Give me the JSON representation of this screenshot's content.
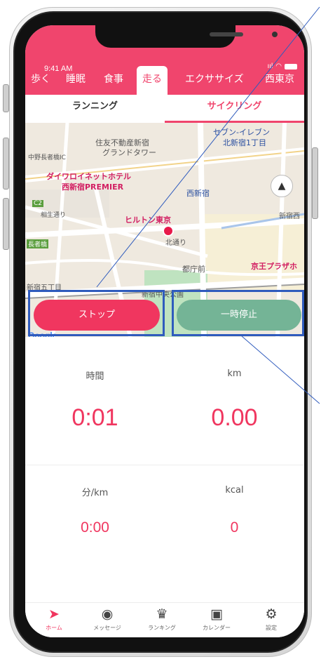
{
  "status_bar": {
    "time": "9:41 AM",
    "signal": "ııl"
  },
  "category_tabs": [
    {
      "label": "歩く"
    },
    {
      "label": "睡眠"
    },
    {
      "label": "食事"
    },
    {
      "label": "走る"
    },
    {
      "label": "エクササイズ"
    },
    {
      "label": "西東京"
    }
  ],
  "active_category": "走る",
  "sub_tabs": {
    "running": "ランニング",
    "cycling": "サイクリング",
    "active": "サイクリング"
  },
  "map": {
    "labels": {
      "seven_eleven_1": "セブン-イレブン",
      "seven_eleven_2": "北新宿1丁目",
      "sumitomo_1": "住友不動産新宿",
      "sumitomo_2": "グランドタワー",
      "nakano": "中野長者橋IC",
      "daiwa_1": "ダイワロイネットホテル",
      "daiwa_2": "西新宿PREMIER",
      "nishishinjuku": "西新宿",
      "c2": "C2",
      "aiko": "相生通り",
      "hilton": "ヒルトン東京",
      "kitadori": "北通り",
      "shinjuku_nishi": "新宿西",
      "chojabashi": "長者橋",
      "tochomae": "都庁前",
      "keio_plaza": "京王プラザホ",
      "shinjuku_5": "新宿五丁目",
      "central_park": "新宿中央公園"
    },
    "google_logo": "Google"
  },
  "buttons": {
    "stop": "ストップ",
    "pause": "一時停止"
  },
  "stats": {
    "time_label": "時間",
    "time_value": "0:01",
    "distance_label": "km",
    "distance_value": "0.00",
    "pace_label": "分/km",
    "pace_value": "0:00",
    "calories_label": "kcal",
    "calories_value": "0"
  },
  "bottom_nav": [
    {
      "label": "ホーム",
      "icon": "home-arrow-icon"
    },
    {
      "label": "メッセージ",
      "icon": "message-icon"
    },
    {
      "label": "ランキング",
      "icon": "crown-icon"
    },
    {
      "label": "カレンダー",
      "icon": "calendar-icon"
    },
    {
      "label": "設定",
      "icon": "gear-icon"
    }
  ],
  "colors": {
    "accent": "#f0456d",
    "stop": "#f0365f",
    "pause": "#74b496",
    "highlight": "#2f5bbd"
  }
}
